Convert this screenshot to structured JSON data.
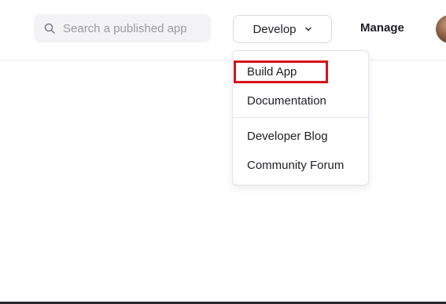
{
  "header": {
    "search": {
      "placeholder": "Search a published app",
      "value": ""
    },
    "develop_label": "Develop",
    "manage_label": "Manage"
  },
  "dropdown": {
    "items": [
      {
        "label": "Build App",
        "highlighted": true
      },
      {
        "label": "Documentation"
      },
      {
        "label": "Developer Blog"
      },
      {
        "label": "Community Forum"
      }
    ]
  },
  "colors": {
    "accent_highlight": "#d8101a",
    "text": "#1f1f24",
    "muted": "#9a9aa3"
  },
  "icons": {
    "search": "search-icon",
    "develop_chevron": "chevron-down-icon",
    "avatar": "avatar"
  }
}
